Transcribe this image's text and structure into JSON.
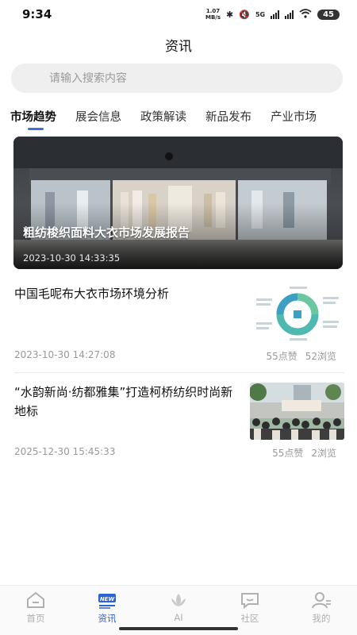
{
  "status_bar": {
    "time": "9:34",
    "net_speed_value": "1.07",
    "net_speed_unit": "MB/s",
    "network_type": "5G",
    "battery": "45"
  },
  "header": {
    "title": "资讯"
  },
  "search": {
    "placeholder": "请输入搜索内容"
  },
  "tabs": [
    {
      "label": "市场趋势",
      "active": true
    },
    {
      "label": "展会信息",
      "active": false
    },
    {
      "label": "政策解读",
      "active": false
    },
    {
      "label": "新品发布",
      "active": false
    },
    {
      "label": "产业市场",
      "active": false
    }
  ],
  "hero": {
    "title": "粗纺梭织面料大衣市场发展报告",
    "date": "2023-10-30 14:33:35"
  },
  "news": [
    {
      "title": "中国毛呢布大衣市场环境分析",
      "date": "2023-10-30 14:27:08",
      "likes": "55点赞",
      "views": "52浏览",
      "thumb_icon": "swot-diagram-thumbnail"
    },
    {
      "title": "“水韵新尚·纺都雅集”打造柯桥纺织时尚新地标",
      "date": "2025-12-30 15:45:33",
      "likes": "55点赞",
      "views": "2浏览",
      "thumb_icon": "crowd-event-photo-thumbnail"
    }
  ],
  "bottom_nav": [
    {
      "label": "首页",
      "icon": "home-icon",
      "active": false
    },
    {
      "label": "资讯",
      "icon": "news-icon",
      "active": true
    },
    {
      "label": "AI",
      "icon": "ai-lotus-icon",
      "active": false
    },
    {
      "label": "社区",
      "icon": "community-chat-icon",
      "active": false
    },
    {
      "label": "我的",
      "icon": "profile-icon",
      "active": false
    }
  ],
  "colors": {
    "accent": "#2c63d6",
    "tab_indicator": "#3b6fe0",
    "muted_text": "#999999"
  }
}
